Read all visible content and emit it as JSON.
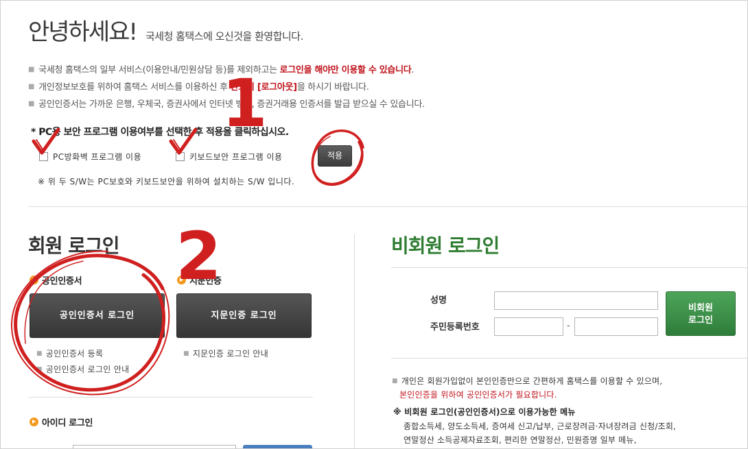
{
  "greeting": {
    "title": "안녕하세요!",
    "subtitle": "국세청 홈택스에 오신것을 환영합니다."
  },
  "notices": [
    {
      "before": "국세청 홈택스의 일부 서비스(이용안내/민원상담 등)를 제외하고는 ",
      "highlight": "로그인을 해야만 이용할 수 있습니다",
      "after": "."
    },
    {
      "before": "개인정보보호를 위하여 홈택스 서비스를 이용하신 후 ",
      "highlight": "반드시 [로그아웃]",
      "after": "을 하시기 바랍니다."
    },
    {
      "before": "공인인증서는 가까운 은행, 우체국, 증권사에서 인터넷 뱅킹, 증권거래용 인증서를 발급 받으실 수 있습니다.",
      "highlight": "",
      "after": ""
    }
  ],
  "security": {
    "title": "* PC용 보안 프로그램 이용여부를 선택한 후 적용을 클릭하십시오.",
    "firewall_label": "PC방화벽 프로그램 이용",
    "keyboard_label": "키보드보안 프로그램 이용",
    "apply_label": "적용",
    "note": "※ 위 두 S/W는 PC보호와 키보드보안을 위하여 설치하는 S/W 입니다."
  },
  "member": {
    "title": "회원 로그인",
    "cert_title": "공인인증서",
    "cert_button": "공인인증서 로그인",
    "finger_title": "지문인증",
    "finger_button": "지문인증 로그인",
    "cert_links": [
      "공인인증서 등록",
      "공인인증서 로그인 안내"
    ],
    "finger_links": [
      "지문인증 로그인 안내"
    ],
    "id_title": "아이디 로그인"
  },
  "guest": {
    "title": "비회원 로그인",
    "name_label": "성명",
    "rrn_label": "주민등록번호",
    "rrn_separator": "-",
    "button_line1": "비회원",
    "button_line2": "로그인",
    "info_line1": "개인은 회원가입없이 본인인증만으로 간편하게 홈택스를 이용할 수 있으며,",
    "info_line2": "본인인증을 위하여 공인인증서가 필요합니다.",
    "menu_title": "※ 비회원 로그인(공인인증서)으로 이용가능한 메뉴",
    "menu_line1": "종합소득세, 양도소득세, 증여세 신고/납부, 근로장려금·자녀장려금 신청/조회,",
    "menu_line2": "연말정산 소득공제자료조회, 편리한 연말정산, 민원증명 일부 메뉴,"
  },
  "annotations": {
    "step1": "1",
    "step2": "2",
    "color": "#d01f1f"
  },
  "colors": {
    "highlight_red": "#c0121b",
    "guest_green": "#2e7d32",
    "orange_bullet": "#f39a1e"
  }
}
